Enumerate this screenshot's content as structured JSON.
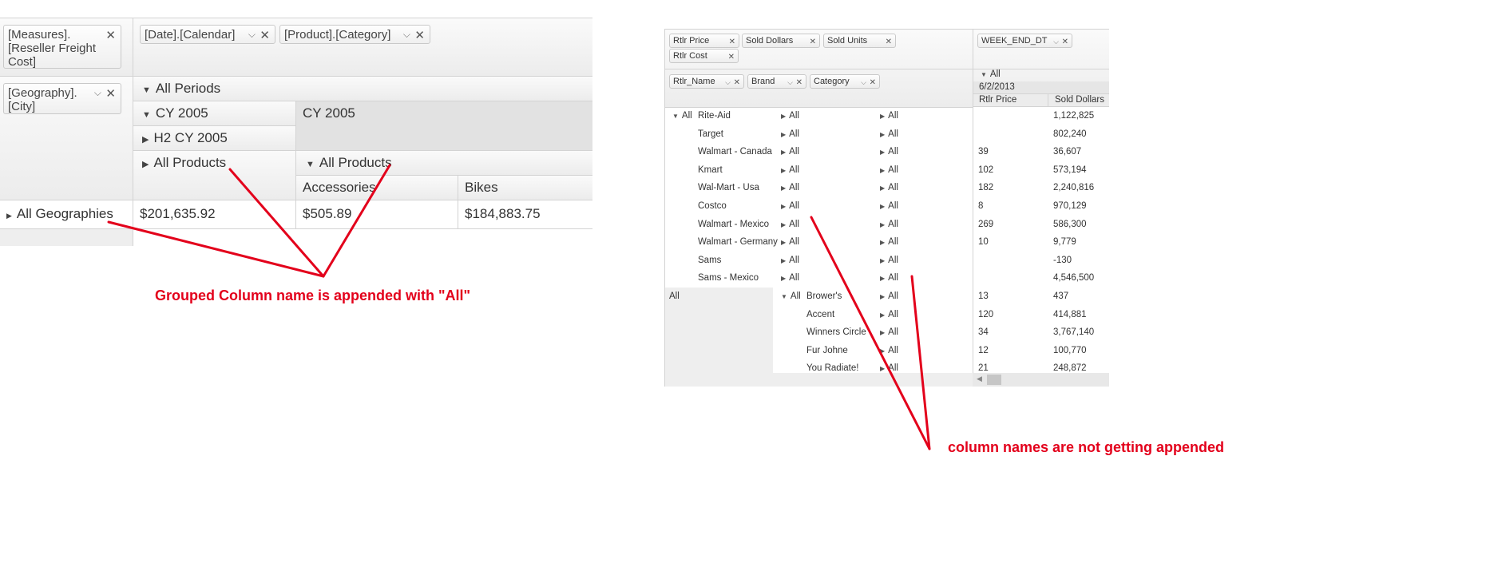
{
  "left_pivot": {
    "filter_chips": {
      "measures": "[Measures].[Reseller Freight Cost]",
      "date": "[Date].[Calendar]",
      "product": "[Product].[Category]",
      "geography": "[Geography].[City]"
    },
    "headers": {
      "all_periods": "All Periods",
      "cy2005": "CY 2005",
      "cy2005_col": "CY 2005",
      "h2cy2005": "H2 CY 2005",
      "all_products_left": "All Products",
      "all_products_right": "All Products",
      "accessories": "Accessories",
      "bikes": "Bikes"
    },
    "row": {
      "label": "All Geographies",
      "values": [
        "$201,635.92",
        "$505.89",
        "$184,883.75"
      ]
    }
  },
  "annotations": {
    "left_note": "Grouped Column name is appended with \"All\"",
    "right_note": "column names are not getting appended"
  },
  "right_pivot": {
    "value_chips": [
      "Rtlr Price",
      "Sold Dollars",
      "Sold Units",
      "Rtlr Cost"
    ],
    "column_chip": "WEEK_END_DT",
    "row_chips": [
      "Rtlr_Name",
      "Brand",
      "Category"
    ],
    "col_headers": {
      "all": "All",
      "date": "6/2/2013",
      "rtlr_price": "Rtlr Price",
      "sold_dollars": "Sold Dollars"
    },
    "group_label_top": "All",
    "group_label_bottom": "All",
    "rows_top": [
      {
        "name": "Rite-Aid",
        "c1": "All",
        "c2": "All",
        "price": "",
        "dollars": "1,122,825"
      },
      {
        "name": "Target",
        "c1": "All",
        "c2": "All",
        "price": "",
        "dollars": "802,240"
      },
      {
        "name": "Walmart - Canada",
        "c1": "All",
        "c2": "All",
        "price": "39",
        "dollars": "36,607"
      },
      {
        "name": "Kmart",
        "c1": "All",
        "c2": "All",
        "price": "102",
        "dollars": "573,194"
      },
      {
        "name": "Wal-Mart - Usa",
        "c1": "All",
        "c2": "All",
        "price": "182",
        "dollars": "2,240,816"
      },
      {
        "name": "Costco",
        "c1": "All",
        "c2": "All",
        "price": "8",
        "dollars": "970,129"
      },
      {
        "name": "Walmart - Mexico",
        "c1": "All",
        "c2": "All",
        "price": "269",
        "dollars": "586,300"
      },
      {
        "name": "Walmart - Germany",
        "c1": "All",
        "c2": "All",
        "price": "10",
        "dollars": "9,779"
      },
      {
        "name": "Sams",
        "c1": "All",
        "c2": "All",
        "price": "",
        "dollars": "-130"
      },
      {
        "name": "Sams - Mexico",
        "c1": "All",
        "c2": "All",
        "price": "",
        "dollars": "4,546,500"
      }
    ],
    "brand_group_label": "All",
    "rows_bottom": [
      {
        "brand": "Brower's",
        "c2": "All",
        "price": "13",
        "dollars": "437"
      },
      {
        "brand": "Accent",
        "c2": "All",
        "price": "120",
        "dollars": "414,881"
      },
      {
        "brand": "Winners Circle",
        "c2": "All",
        "price": "34",
        "dollars": "3,767,140"
      },
      {
        "brand": "Fur Johne",
        "c2": "All",
        "price": "12",
        "dollars": "100,770"
      },
      {
        "brand": "You Radiate!",
        "c2": "All",
        "price": "21",
        "dollars": "248,872"
      }
    ]
  },
  "colors": {
    "annotation": "#e3001b",
    "border": "#d3d3d3"
  }
}
